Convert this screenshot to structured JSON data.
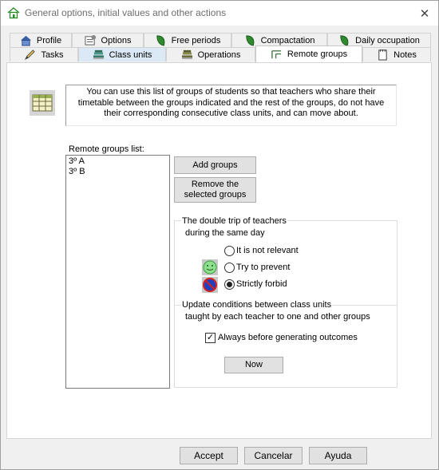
{
  "window": {
    "title": "General options, initial values and other actions",
    "close_glyph": "✕"
  },
  "tabs": {
    "row1": [
      {
        "label": "Profile",
        "icon": "house-icon"
      },
      {
        "label": "Options",
        "icon": "options-icon"
      },
      {
        "label": "Free periods",
        "icon": "leaf-icon"
      },
      {
        "label": "Compactation",
        "icon": "leaf-icon"
      },
      {
        "label": "Daily occupation",
        "icon": "leaf-icon"
      }
    ],
    "row2": [
      {
        "label": "Tasks",
        "icon": "pencil-icon"
      },
      {
        "label": "Class units",
        "icon": "books-icon"
      },
      {
        "label": "Operations",
        "icon": "books-icon"
      },
      {
        "label": "Remote groups",
        "icon": "groups-icon"
      },
      {
        "label": "Notes",
        "icon": "notes-icon"
      }
    ],
    "active": "Remote groups"
  },
  "info": {
    "text": "You can use this list of groups of students so that teachers who share their timetable between the groups indicated and the rest of the groups, do not have their corresponding consecutive class units, and can move about."
  },
  "remote_groups": {
    "list_label": "Remote groups list:",
    "items": [
      "3º A",
      "3º B"
    ],
    "add_button": "Add groups",
    "remove_button": "Remove the selected groups"
  },
  "double_trip": {
    "heading_line1": "The double trip of teachers",
    "heading_line2": "during the same day",
    "options": [
      {
        "label": "It is not relevant",
        "checked": false
      },
      {
        "label": "Try to prevent",
        "checked": false
      },
      {
        "label": "Strictly forbid",
        "checked": true
      }
    ]
  },
  "update_conditions": {
    "heading_line1": "Update conditions between class units",
    "heading_line2": "taught by each teacher to one and other groups",
    "checkbox_label": "Always before generating outcomes",
    "checkbox_checked": true,
    "now_button": "Now"
  },
  "footer": {
    "accept": "Accept",
    "cancel": "Cancelar",
    "help": "Ayuda"
  },
  "colors": {
    "accent_tab": "#dbe8f5",
    "smile_face": "#8ee08e",
    "forbid_red": "#d42020",
    "forbid_blue": "#2040c0"
  }
}
